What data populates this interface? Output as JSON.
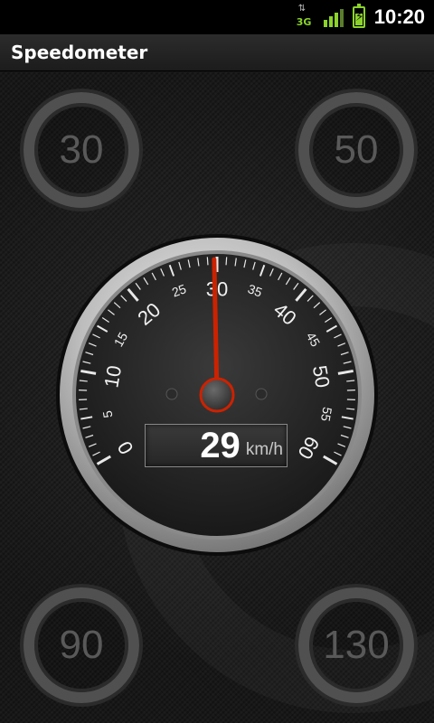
{
  "status_bar": {
    "time": "10:20",
    "network": "3G",
    "signal_icon": "signal-bars-icon",
    "battery_icon": "battery-charging-icon"
  },
  "app": {
    "title": "Speedometer"
  },
  "speed_limits": [
    "30",
    "50",
    "90",
    "130"
  ],
  "gauge": {
    "min": 0,
    "max": 60,
    "start_angle_deg": 240,
    "sweep_deg": 240,
    "major_labels": [
      "0",
      "10",
      "20",
      "30",
      "40",
      "50",
      "60"
    ],
    "minor_labels": [
      "5",
      "15",
      "25",
      "35",
      "45",
      "55"
    ],
    "needle_value": 29.7
  },
  "readout": {
    "speed": "29",
    "unit": "km/h"
  },
  "colors": {
    "needle": "#cc2200",
    "accent": "#8bd32b"
  }
}
